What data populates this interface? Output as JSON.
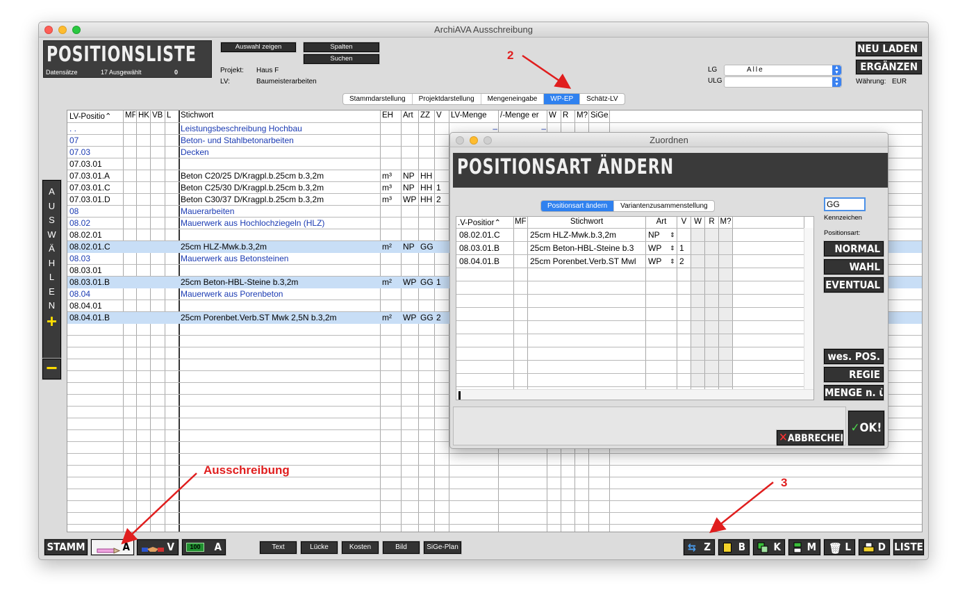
{
  "window": {
    "title": "ArchiAVA Ausschreibung"
  },
  "header": {
    "title": "POSITIONSLISTE",
    "datensaetze_label": "Datensätze",
    "ausgewaehlt": "17 Ausgewählt",
    "count": "0",
    "btn_auswahl": "Auswahl zeigen",
    "btn_spalten": "Spalten",
    "btn_suchen": "Suchen",
    "projekt_label": "Projekt:",
    "projekt_value": "Haus F",
    "lv_label": "LV:",
    "lv_value": "Baumeisterarbeiten",
    "lg_label": "LG",
    "lg_value": "Alle",
    "ulg_label": "ULG",
    "ulg_value": "",
    "btn_neu_laden": "NEU LADEN",
    "btn_ergaenzen": "ERGÄNZEN",
    "waehrung_label": "Währung:",
    "waehrung_value": "EUR"
  },
  "tabs": [
    {
      "label": "Stammdarstellung"
    },
    {
      "label": "Projektdarstellung"
    },
    {
      "label": "Mengeneingabe"
    },
    {
      "label": "WP-EP",
      "active": true
    },
    {
      "label": "Schätz-LV"
    }
  ],
  "table": {
    "columns": [
      "LV-Positio⌃",
      "MF",
      "HK",
      "VB",
      "L",
      "Stichwort",
      "EH",
      "Art",
      "ZZ",
      "V",
      "LV-Menge",
      "/-Menge er",
      "W",
      "R",
      "M?",
      "SiGe/"
    ],
    "rows": [
      {
        "pos": ". .",
        "stich": "Leistungsbeschreibung Hochbau",
        "blue": true,
        "lvm": "–",
        "vm": "–"
      },
      {
        "pos": "07",
        "stich": "Beton- und Stahlbetonarbeiten",
        "blue": true
      },
      {
        "pos": "07.03",
        "stich": "Decken",
        "blue": true
      },
      {
        "pos": "07.03.01",
        "stich": ""
      },
      {
        "pos": "07.03.01.A",
        "stich": "Beton C20/25 D/Kragpl.b.25cm b.3,2m",
        "eh": "m³",
        "art": "NP",
        "zz": "HH",
        "v": ""
      },
      {
        "pos": "07.03.01.C",
        "stich": "Beton C25/30 D/Kragpl.b.25cm b.3,2m",
        "eh": "m³",
        "art": "NP",
        "zz": "HH",
        "v": "1"
      },
      {
        "pos": "07.03.01.D",
        "stich": "Beton C30/37 D/Kragpl.b.25cm b.3,2m",
        "eh": "m³",
        "art": "WP",
        "zz": "HH",
        "v": "2"
      },
      {
        "pos": "08",
        "stich": "Mauerarbeiten",
        "blue": true
      },
      {
        "pos": "08.02",
        "stich": "Mauerwerk aus Hochlochziegeln (HLZ)",
        "blue": true
      },
      {
        "pos": "08.02.01",
        "stich": ""
      },
      {
        "pos": "08.02.01.C",
        "stich": "25cm HLZ-Mwk.b.3,2m",
        "eh": "m²",
        "art": "NP",
        "zz": "GG",
        "v": "",
        "sel": true
      },
      {
        "pos": "08.03",
        "stich": "Mauerwerk aus Betonsteinen",
        "blue": true
      },
      {
        "pos": "08.03.01",
        "stich": ""
      },
      {
        "pos": "08.03.01.B",
        "stich": "25cm Beton-HBL-Steine b.3,2m",
        "eh": "m²",
        "art": "WP",
        "zz": "GG",
        "v": "1",
        "sel": true
      },
      {
        "pos": "08.04",
        "stich": "Mauerwerk aus Porenbeton",
        "blue": true
      },
      {
        "pos": "08.04.01",
        "stich": ""
      },
      {
        "pos": "08.04.01.B",
        "stich": "25cm Porenbet.Verb.ST Mwk 2,5N b.3,2m",
        "eh": "m²",
        "art": "WP",
        "zz": "GG",
        "v": "2",
        "sel": true
      }
    ]
  },
  "side": {
    "auswaehlen": "AUSWÄHLEN",
    "plus": "+",
    "minus": "−"
  },
  "bottom_left": {
    "stamm": "STAMM",
    "a1": "A",
    "v": "V",
    "badge": "100",
    "a2": "A"
  },
  "bottom_mid": {
    "text": "Text",
    "luecke": "Lücke",
    "kosten": "Kosten",
    "bild": "Bild",
    "sige": "SiGe-Plan"
  },
  "bottom_right": {
    "z": "Z",
    "b": "B",
    "k": "K",
    "m": "M",
    "l": "L",
    "d": "D",
    "liste": "LISTE"
  },
  "dialog": {
    "title": "Zuordnen",
    "heading": "POSITIONSART ÄNDERN",
    "tabs": [
      {
        "label": "Positionsart ändern",
        "active": true
      },
      {
        "label": "Variantenzusammenstellung"
      }
    ],
    "columns": [
      ".V-Positior⌃",
      "MF",
      "Stichwort",
      "Art",
      "V",
      "W",
      "R",
      "M?"
    ],
    "rows": [
      {
        "pos": "08.02.01.C",
        "stich": "25cm HLZ-Mwk.b.3,2m",
        "art": "NP",
        "v": ""
      },
      {
        "pos": "08.03.01.B",
        "stich": "25cm Beton-HBL-Steine b.3",
        "art": "WP",
        "v": "1"
      },
      {
        "pos": "08.04.01.B",
        "stich": "25cm Porenbet.Verb.ST Mwl",
        "art": "WP",
        "v": "2"
      }
    ],
    "kennzeichen_value": "GG",
    "kennzeichen_label": "Kennzeichen",
    "positionsart_label": "Positionsart:",
    "btn_normal": "NORMAL",
    "btn_wahl": "WAHL",
    "btn_eventual": "EVENTUAL",
    "btn_wes_pos": "wes. POS.",
    "btn_regie": "REGIE",
    "btn_menge": "MENGE n. ü.",
    "btn_abbrechen": "ABBRECHEN",
    "btn_ok": "OK!"
  },
  "annotations": {
    "a2": "2",
    "a3": "3",
    "ausschreibung": "Ausschreibung"
  },
  "colors": {
    "accent": "#2f81ef",
    "selection": "#c8def6",
    "annotation": "#e01e1e",
    "dark_button": "#333333"
  }
}
